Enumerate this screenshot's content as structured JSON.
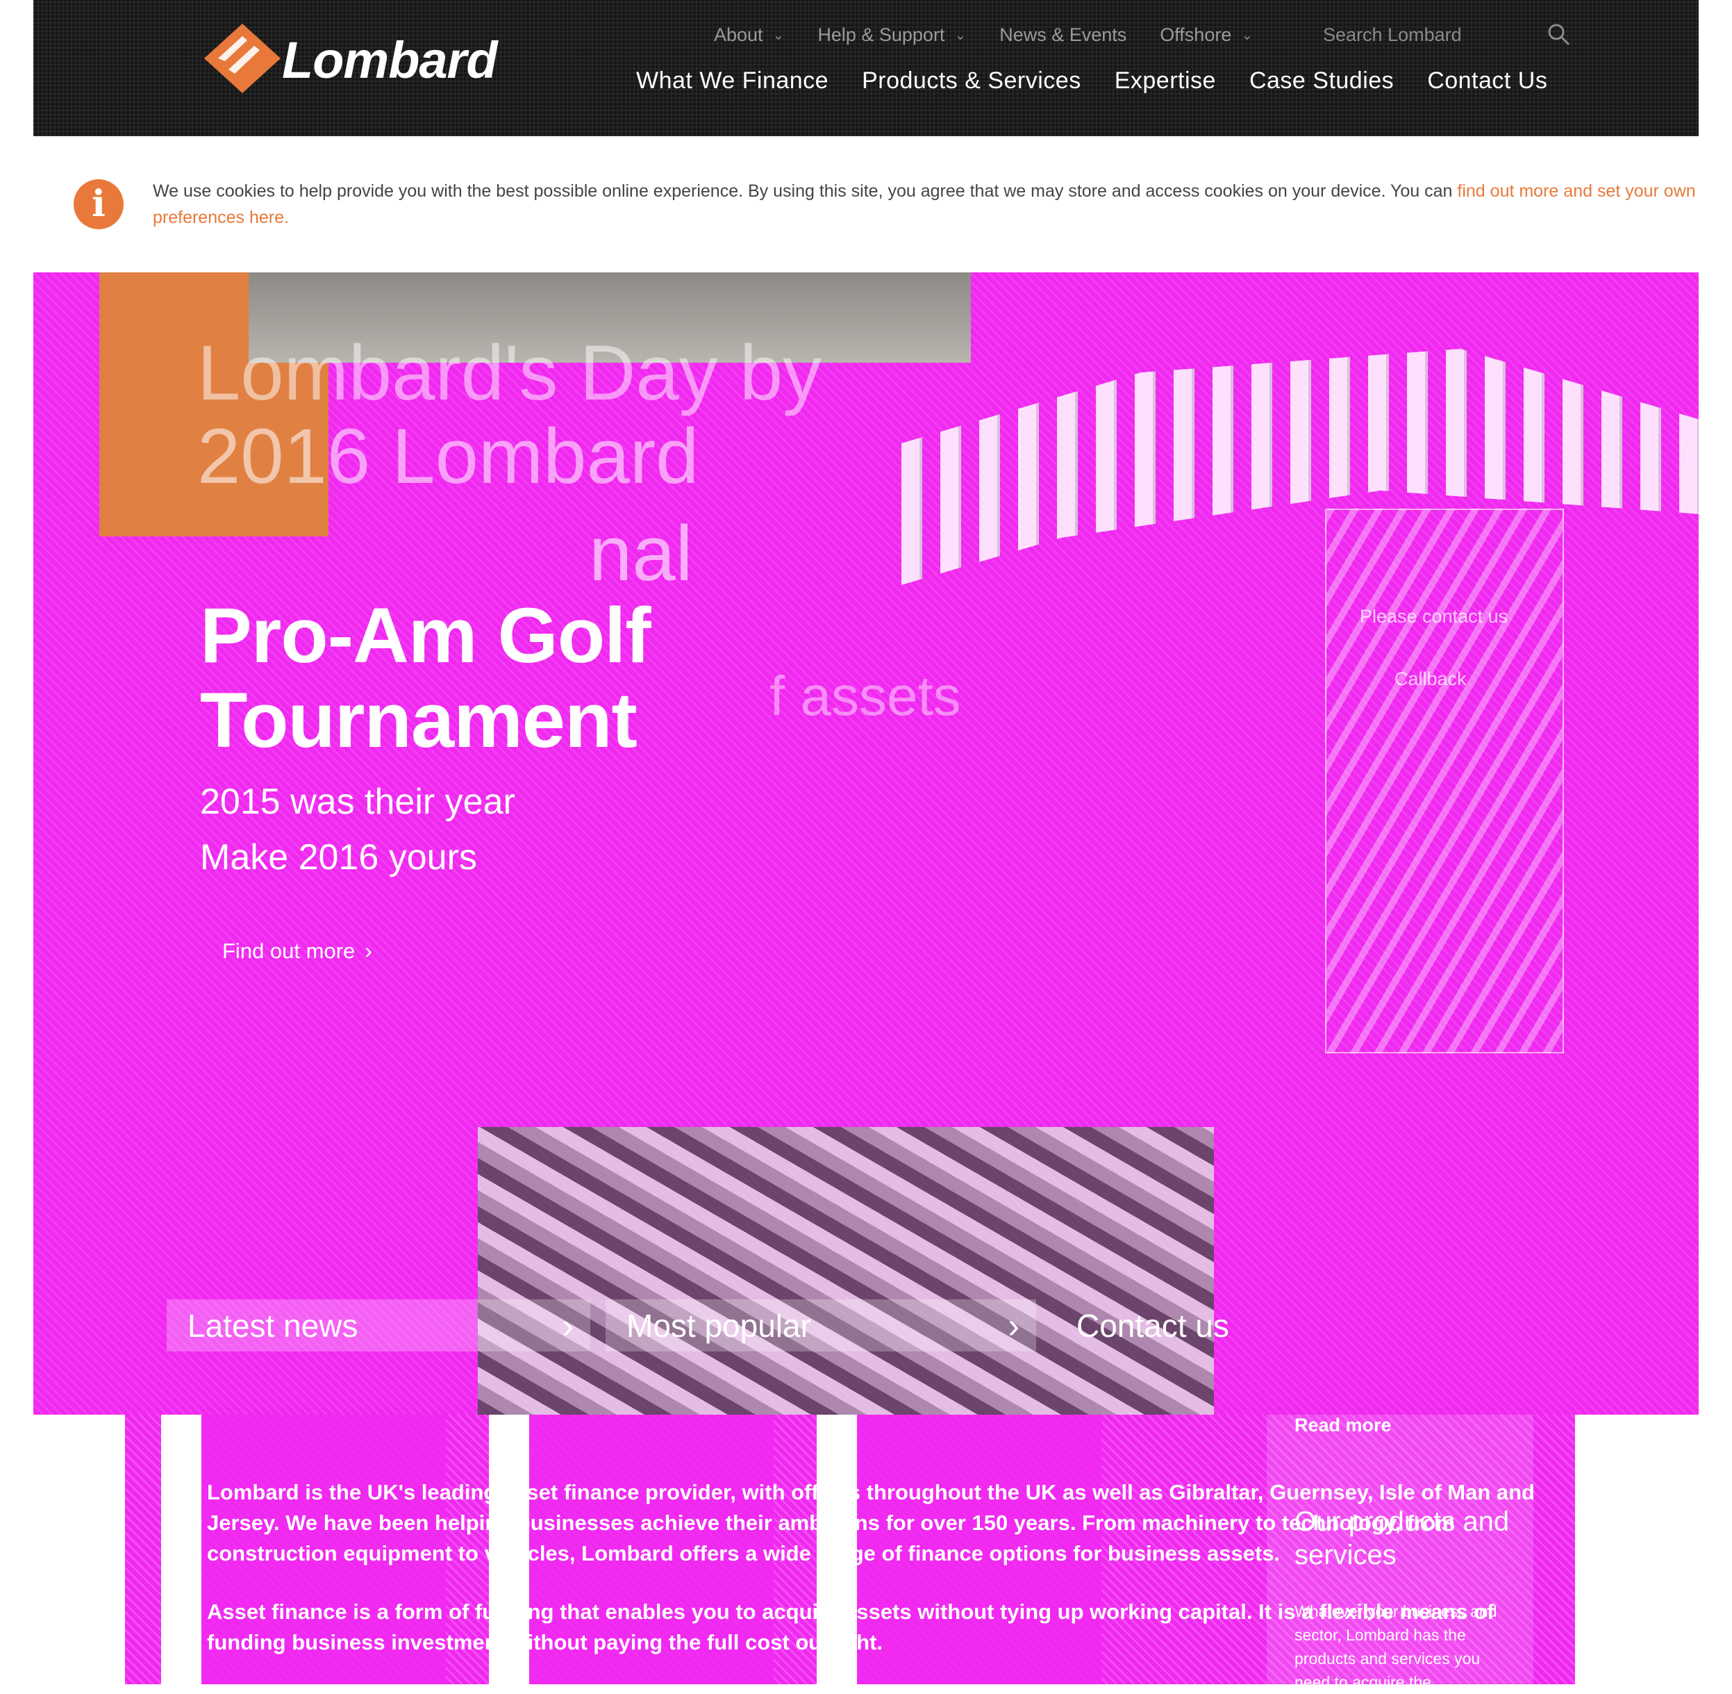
{
  "brand": {
    "name": "Lombard",
    "accent": "#e8793a",
    "overlay_color": "#f028f0"
  },
  "topnav": [
    {
      "label": "About",
      "has_dropdown": true
    },
    {
      "label": "Help & Support",
      "has_dropdown": true
    },
    {
      "label": "News & Events",
      "has_dropdown": false
    },
    {
      "label": "Offshore",
      "has_dropdown": true
    }
  ],
  "search": {
    "placeholder": "Search Lombard",
    "icon": "search-icon"
  },
  "mainnav": [
    {
      "label": "What We Finance"
    },
    {
      "label": "Products & Services"
    },
    {
      "label": "Expertise"
    },
    {
      "label": "Case Studies"
    },
    {
      "label": "Contact Us"
    }
  ],
  "cookie": {
    "icon": "info-icon",
    "text": "We use cookies to help provide you with the best possible online experience. By using this site, you agree that we may store and access cookies on your device. You can ",
    "link": "find out more and set your own preferences here."
  },
  "hero": {
    "title_lines": [
      "Pro-Am Golf",
      "Tournament"
    ],
    "ghost_1": "Lombard's Day by",
    "ghost_2": "2016 Lombard",
    "ghost_3": "nal",
    "ghost_4": "f assets",
    "subtitle_lines": [
      "2015 was their year",
      "Make 2016 yours"
    ],
    "cta": "Find out more",
    "side": {
      "item1": "Please contact us",
      "item2": "Callback"
    }
  },
  "tabs": {
    "latest": "Latest news",
    "popular": "Most popular",
    "contact": "Contact us"
  },
  "intro": {
    "p1": "Lombard is the UK's leading asset finance provider, with offices throughout the UK as well as Gibraltar, Guernsey, Isle of Man and Jersey. We have been helping businesses achieve their ambitions for over 150 years. From machinery to technology, from construction equipment to vehicles, Lombard offers a wide range of finance options for business assets.",
    "p2": "Asset finance is a form of funding that enables you to acquire assets without tying up working capital. It is a flexible means of funding business investment without paying the full cost outright."
  },
  "sidebar": {
    "read_more": "Read more",
    "heading": "Our products and services",
    "body": "Whatever your business and sector, Lombard has the products and services you need to acquire the"
  }
}
